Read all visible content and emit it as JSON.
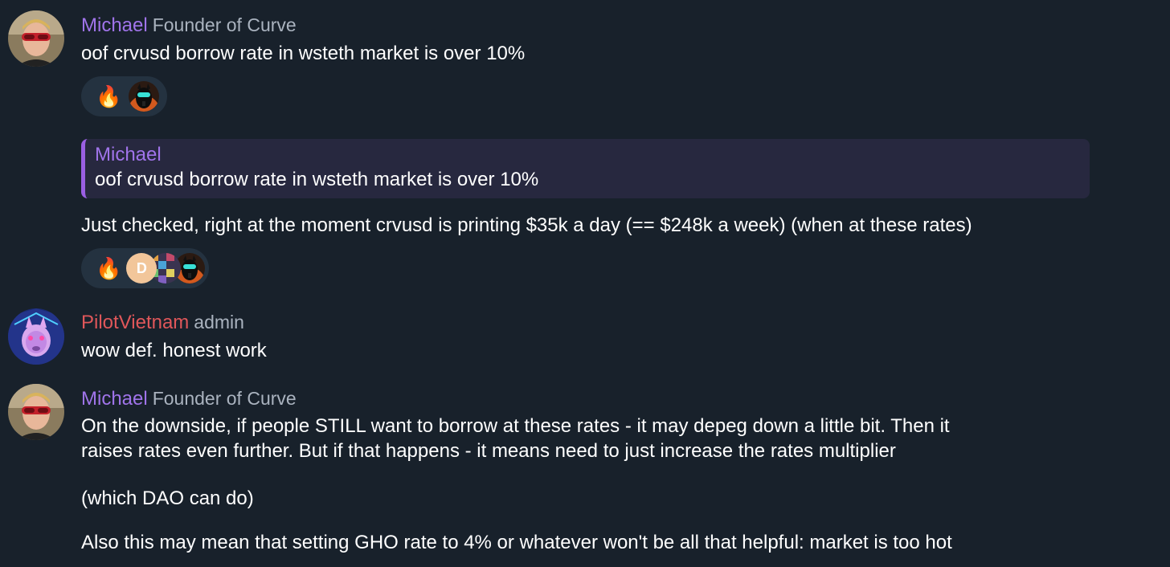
{
  "colors": {
    "background": "#18212b",
    "michael_name": "#a074ea",
    "pilot_name": "#e0575a",
    "role": "#aab3bf",
    "reaction_bg": "#243240",
    "quote_bg": "#27283f",
    "quote_bar": "#9a5fe3"
  },
  "messages": [
    {
      "sender": "Michael",
      "role": "Founder of Curve",
      "text": "oof crvusd borrow rate in wsteth market is over 10%",
      "reactions": {
        "emoji": "🔥",
        "icons": [
          "fire-emoji",
          "llama-avatar"
        ]
      }
    },
    {
      "quote": {
        "sender": "Michael",
        "text": "oof crvusd borrow rate in wsteth market is over 10%"
      },
      "text": "Just checked, right at the moment crvusd is printing $35k a day (== $248k a week) (when at these rates)",
      "reactions": {
        "emoji": "🔥",
        "letter_avatar": "D",
        "icons": [
          "fire-emoji",
          "letter-avatar",
          "mosaic-avatar",
          "llama-avatar"
        ]
      }
    },
    {
      "sender": "PilotVietnam",
      "role": "admin",
      "text": "wow def. honest work"
    },
    {
      "sender": "Michael",
      "role": "Founder of Curve",
      "lines": [
        "On the downside, if people STILL want to borrow at these rates - it may depeg down a little bit. Then it",
        "raises rates even further. But if that happens - it means need to just increase the rates multiplier",
        "(which DAO can do)",
        "Also this may mean that setting GHO rate to 4% or whatever won't be all that helpful: market is too hot"
      ]
    }
  ]
}
